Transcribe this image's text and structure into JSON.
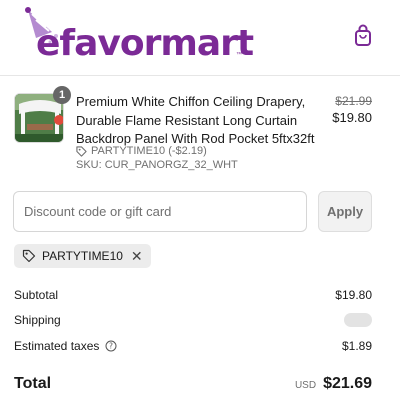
{
  "header": {
    "logo_text": "efavormart",
    "brand_color": "#7b2a96",
    "cart_icon": "shopping-bag-icon"
  },
  "item": {
    "quantity": "1",
    "title": "Premium White Chiffon Ceiling Drapery, Durable Flame Resistant Long Curtain Backdrop Panel With Rod Pocket 5ftx32ft",
    "original_price": "$21.99",
    "price": "$19.80",
    "discount": "PARTYTIME10 (-$2.19)",
    "sku": "SKU: CUR_PANORGZ_32_WHT",
    "discount_icon": "tag-icon"
  },
  "discount_form": {
    "placeholder": "Discount code or gift card",
    "value": "",
    "apply_label": "Apply"
  },
  "applied_code": {
    "code": "PARTYTIME10",
    "icon": "tag-icon",
    "remove_icon": "close-icon"
  },
  "summary": {
    "subtotal_label": "Subtotal",
    "subtotal_value": "$19.80",
    "shipping_label": "Shipping",
    "taxes_label": "Estimated taxes",
    "taxes_value": "$1.89",
    "info_icon": "help-circle-icon"
  },
  "total": {
    "label": "Total",
    "currency": "USD",
    "amount": "$21.69"
  }
}
